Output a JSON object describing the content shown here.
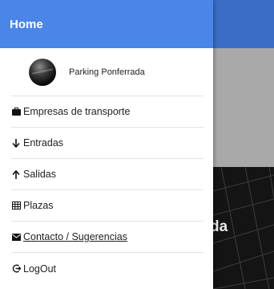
{
  "drawer": {
    "title": "Home",
    "profile": {
      "name": "Parking Ponferrada",
      "avatar_icon": "avatar-image"
    },
    "items": [
      {
        "label": "Empresas de transporte",
        "icon": "briefcase-icon"
      },
      {
        "label": "Entradas",
        "icon": "arrow-down-icon"
      },
      {
        "label": "Salidas",
        "icon": "arrow-up-icon"
      },
      {
        "label": "Plazas",
        "icon": "grid-icon"
      },
      {
        "label": "Contacto / Sugerencias",
        "icon": "envelope-icon"
      },
      {
        "label": "LogOut",
        "icon": "logout-icon"
      }
    ]
  },
  "background": {
    "partial_text": "da"
  },
  "colors": {
    "drawer_header": "#4a86e8",
    "app_header": "#3a6dc4",
    "app_gray": "#a9a9a9",
    "app_dark": "#141414"
  }
}
